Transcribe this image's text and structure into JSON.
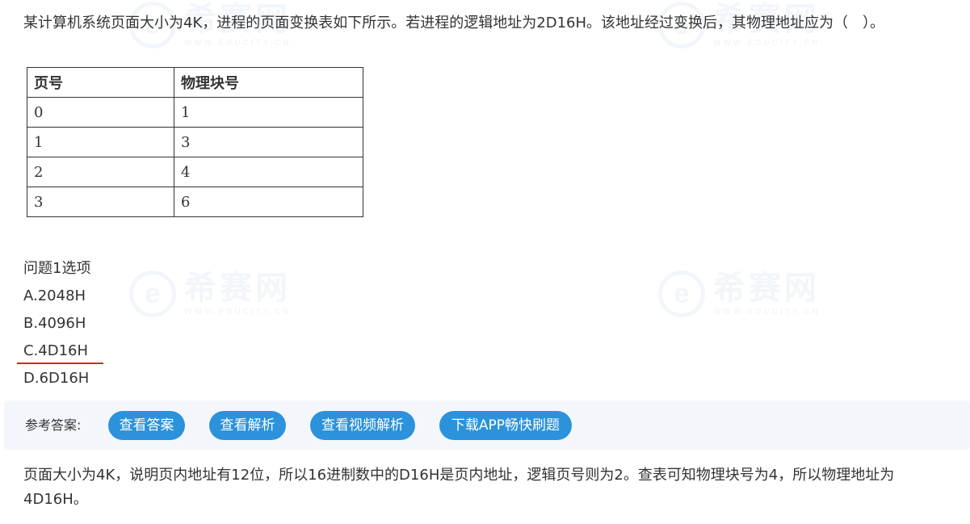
{
  "watermark": {
    "logo_glyph": "e",
    "brand": "希赛网",
    "domain": "WWW.EDUCITY.CN"
  },
  "question": {
    "text": "某计算机系统页面大小为4K，进程的页面变换表如下所示。若进程的逻辑地址为2D16H。该地址经过变换后，其物理地址应为（　）。"
  },
  "table": {
    "headers": [
      "页号",
      "物理块号"
    ],
    "rows": [
      [
        "0",
        "1"
      ],
      [
        "1",
        "3"
      ],
      [
        "2",
        "4"
      ],
      [
        "3",
        "6"
      ]
    ]
  },
  "options": {
    "title": "问题1选项",
    "items": [
      "A.2048H",
      "B.4096H",
      "C.4D16H",
      "D.6D16H"
    ]
  },
  "answer_bar": {
    "label": "参考答案:",
    "buttons": [
      "查看答案",
      "查看解析",
      "查看视频解析",
      "下载APP畅快刷题"
    ]
  },
  "explanation": {
    "text": "页面大小为4K，说明页内地址有12位，所以16进制数中的D16H是页内地址，逻辑页号则为2。查表可知物理块号为4，所以物理地址为4D16H。"
  },
  "colors": {
    "button": "#2b92db",
    "underline": "#e02020",
    "bar_bg": "#f3f7fb"
  }
}
